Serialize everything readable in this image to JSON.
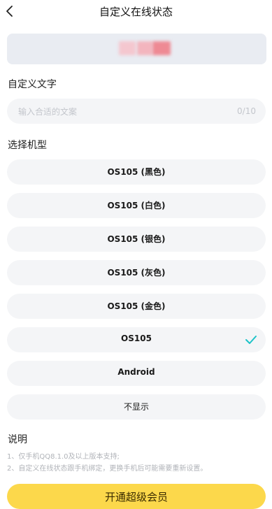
{
  "header": {
    "title": "自定义在线状态"
  },
  "custom_text": {
    "label": "自定义文字",
    "placeholder": "输入合适的文案",
    "counter": "0/10"
  },
  "model": {
    "label": "选择机型",
    "options": [
      {
        "label": "OS105 (黑色)",
        "selected": false
      },
      {
        "label": "OS105 (白色)",
        "selected": false
      },
      {
        "label": "OS105 (银色)",
        "selected": false
      },
      {
        "label": "OS105 (灰色)",
        "selected": false
      },
      {
        "label": "OS105 (金色)",
        "selected": false
      },
      {
        "label": "OS105",
        "selected": true
      },
      {
        "label": "Android",
        "selected": false
      },
      {
        "label": "不显示",
        "selected": false
      }
    ]
  },
  "notes": {
    "title": "说明",
    "lines": [
      "1、仅手机QQ8.1.0及以上版本支持;",
      "2、自定义在线状态跟手机绑定，更换手机后可能需要重新设置。"
    ]
  },
  "cta": {
    "label": "开通超级会员"
  },
  "colors": {
    "accent": "#1cc3c8",
    "cta": "#fcd84b",
    "option_bg": "#f4f5f7"
  }
}
